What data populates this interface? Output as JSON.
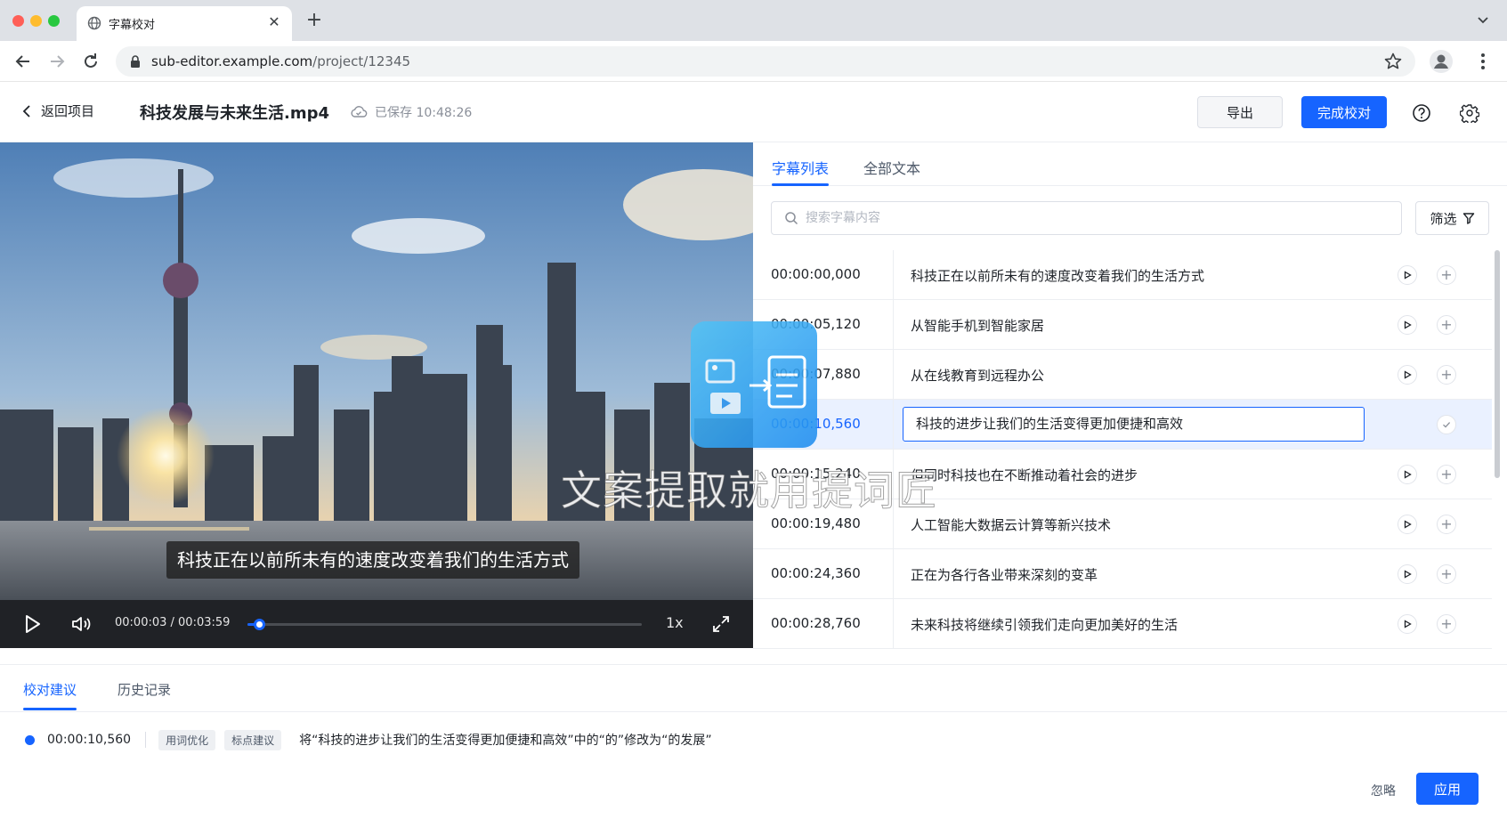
{
  "browser": {
    "tab_title": "字幕校对",
    "url_host": "sub-editor.example.com",
    "url_path": "/project/12345"
  },
  "header": {
    "back_label": "返回项目",
    "file_title": "科技发展与未来生活.mp4",
    "saved_status": "已保存 10:48:26",
    "export_label": "导出",
    "done_label": "完成校对"
  },
  "player": {
    "caption": "科技正在以前所未有的速度改变着我们的生活方式",
    "time": "00:00:03 / 00:03:59",
    "progress_fraction": 0.03,
    "speed": "1x"
  },
  "panel": {
    "tabs": [
      {
        "label": "字幕列表",
        "active": true
      },
      {
        "label": "全部文本",
        "active": false
      }
    ],
    "search_placeholder": "搜索字幕内容",
    "filter_label": "筛选",
    "rows": [
      {
        "time": "00:00:00,000",
        "text": "科技正在以前所未有的速度改变着我们的生活方式"
      },
      {
        "time": "00:00:05,120",
        "text": "从智能手机到智能家居"
      },
      {
        "time": "00:00:07,880",
        "text": "从在线教育到远程办公"
      },
      {
        "time": "00:00:10,560",
        "text": "科技的进步让我们的生活变得更加便捷和高效",
        "editing": true
      },
      {
        "time": "00:00:15,240",
        "text": "但同时科技也在不断推动着社会的进步"
      },
      {
        "time": "00:00:19,480",
        "text": "人工智能大数据云计算等新兴技术"
      },
      {
        "time": "00:00:24,360",
        "text": "正在为各行各业带来深刻的变革"
      },
      {
        "time": "00:00:28,760",
        "text": "未来科技将继续引领我们走向更加美好的生活"
      }
    ]
  },
  "watermark": {
    "text": "文案提取就用提词匠"
  },
  "bottom": {
    "tabs": [
      {
        "label": "校对建议",
        "active": true
      },
      {
        "label": "历史记录",
        "active": false
      }
    ],
    "suggestion": {
      "time": "00:00:10,560",
      "tags": [
        "用词优化",
        "标点建议"
      ],
      "text": "将“科技的进步让我们的生活变得更加便捷和高效”中的“的”修改为“的发展”"
    },
    "ignore_label": "忽略",
    "apply_label": "应用"
  },
  "colors": {
    "accent": "#1664ff",
    "active_row": "#eaf1ff",
    "player_bar": "#202226"
  }
}
